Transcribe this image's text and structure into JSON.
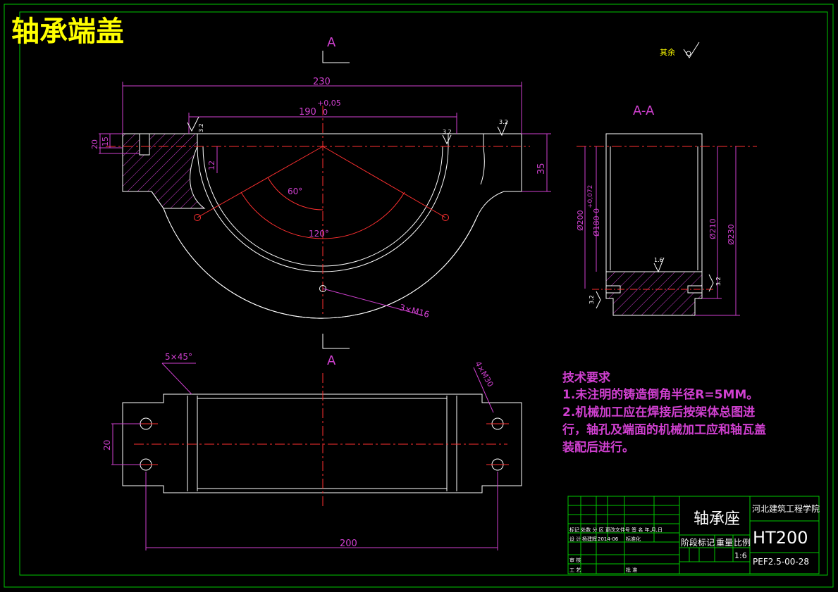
{
  "title": "轴承端盖",
  "section_labels": {
    "top": "A",
    "bottom": "A",
    "section_view": "A-A"
  },
  "roughness_note": {
    "label": "其余"
  },
  "dimensions": {
    "overall_width": "230",
    "bore_width": "190",
    "bore_tol_upper": "+0,05",
    "bore_tol_lower": "0",
    "left_height_outer": "20",
    "left_height_inner": "15",
    "groove_depth": "12",
    "right_height": "35",
    "angle_small": "60°",
    "angle_large": "120°",
    "hole_callout": "3×M16",
    "chamfer": "5×45°",
    "plan_hole_callout": "4×M30",
    "plan_height": "20",
    "plan_length": "200",
    "dia_200": "Ø200",
    "dia_180_tol": "+0,072",
    "dia_180": "Ø180 0",
    "dia_210": "Ø210",
    "dia_230": "Ø230"
  },
  "roughness_values": {
    "r1": "3.2",
    "r2": "3.2",
    "r3": "3.2",
    "r4": "1.6",
    "r5": "3.2",
    "r6": "3.2"
  },
  "tech_requirements": {
    "heading": "技术要求",
    "line1": "1.未注明的铸造倒角半径R=5MM。",
    "line2": "2.机械加工应在焊接后按架体总图进",
    "line3": "行，轴孔及端面的机械加工应和轴瓦盖",
    "line4": "装配后进行。"
  },
  "title_block": {
    "part_name": "轴承座",
    "school": "河北建筑工程学院",
    "material": "HT200",
    "drawing_no": "PEF2.5-00-28",
    "stage_label": "阶段标记",
    "weight_label": "重量",
    "scale_label": "比例",
    "scale_value": "1:6",
    "row_change": "标记 处数 分 区 更改文件号 签 名 年,月,日",
    "row_design": "设 计",
    "row_designer": "杨建辉",
    "row_date": "2014-06",
    "row_std": "标准化",
    "row_review": "审 核",
    "row_process": "工 艺",
    "row_approve": "批 准"
  }
}
